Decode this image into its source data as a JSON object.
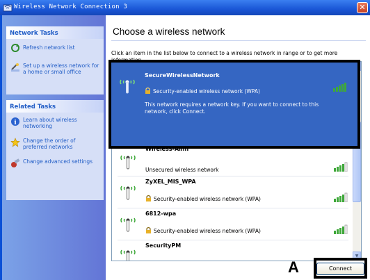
{
  "window": {
    "title": "Wireless Network Connection 3",
    "close_glyph": "✕"
  },
  "sidebar": {
    "network_tasks": {
      "title": "Network Tasks",
      "items": [
        {
          "label": "Refresh network list",
          "icon": "refresh-icon"
        },
        {
          "label": "Set up a wireless network for a home or small office",
          "icon": "setup-wizard-icon"
        }
      ]
    },
    "related_tasks": {
      "title": "Related Tasks",
      "items": [
        {
          "label": "Learn about wireless networking",
          "icon": "info-icon"
        },
        {
          "label": "Change the order of preferred networks",
          "icon": "star-icon"
        },
        {
          "label": "Change advanced settings",
          "icon": "settings-icon"
        }
      ]
    }
  },
  "main": {
    "heading": "Choose a wireless network",
    "instruction": "Click an item in the list below to connect to a wireless network in range or to get more information."
  },
  "networks": [
    {
      "name": "SecureWirelessNetwork",
      "status": "Security-enabled wireless network (WPA)",
      "secured": true,
      "selected": true,
      "description": "This network requires a network key. If you want to connect to this network, click Connect.",
      "signal": 5
    },
    {
      "name": "Wireless-Amn",
      "status": "Unsecured wireless network",
      "secured": false,
      "selected": false,
      "signal": 4
    },
    {
      "name": "ZyXEL_MIS_WPA",
      "status": "Security-enabled wireless network (WPA)",
      "secured": true,
      "selected": false,
      "signal": 4
    },
    {
      "name": "6812-wpa",
      "status": "Security-enabled wireless network (WPA)",
      "secured": true,
      "selected": false,
      "signal": 4
    },
    {
      "name": "SecurityPM",
      "status": "",
      "secured": false,
      "selected": false,
      "signal": 0
    }
  ],
  "buttons": {
    "connect": "Connect"
  },
  "annotation": {
    "label": "A"
  },
  "colors": {
    "title_bar": "#1a56d6",
    "selection": "#3566c2",
    "link": "#215dc6",
    "signal_green": "#3fa83a",
    "lock": "#e8b128"
  }
}
